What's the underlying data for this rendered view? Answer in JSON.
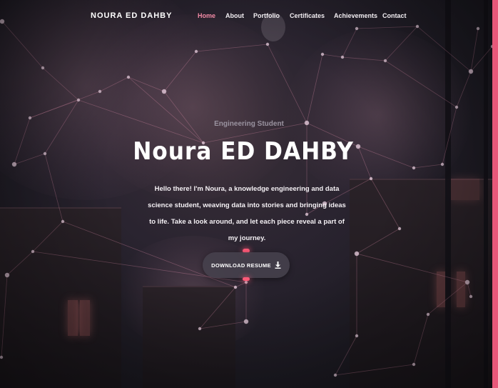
{
  "brand": "NOURA ED DAHBY",
  "nav": [
    {
      "label": "Home",
      "active": true
    },
    {
      "label": "About",
      "active": false
    },
    {
      "label": "Portfolio",
      "active": false
    },
    {
      "label": "Certificates",
      "active": false
    },
    {
      "label": "Achievements",
      "active": false
    },
    {
      "label": "Contact",
      "active": false
    }
  ],
  "hero": {
    "subtitle": "Engineering Student",
    "title": "Noura ED DAHBY",
    "intro": "Hello there! I'm Noura, a knowledge engineering and data science student, weaving data into stories and bringing ideas to life. Take a look around, and let each piece reveal a part of my journey.",
    "button_label": "DOWNLOAD RESUME",
    "button_icon": "download-icon"
  },
  "colors": {
    "accent": "#f28aa5",
    "glow": "#ff5a78",
    "edge": "#e8587a"
  }
}
